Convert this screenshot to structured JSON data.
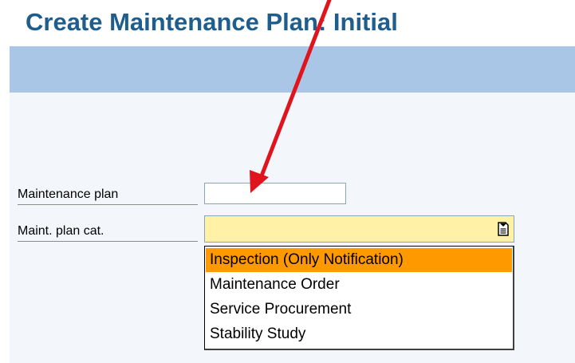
{
  "page": {
    "title": "Create Maintenance Plan: Initial"
  },
  "form": {
    "plan_label": "Maintenance plan",
    "plan_value": "",
    "category_label": "Maint. plan cat.",
    "category_value": ""
  },
  "dropdown": {
    "options": [
      {
        "label": "Inspection (Only Notification)",
        "selected": true
      },
      {
        "label": "Maintenance Order",
        "selected": false
      },
      {
        "label": "Service Procurement",
        "selected": false
      },
      {
        "label": "Stability Study",
        "selected": false
      }
    ]
  },
  "annotation": {
    "arrow_color": "#e0141c"
  },
  "colors": {
    "title": "#1e5d8c",
    "toolbar": "#a9c6e7",
    "selected_field": "#fff2a6",
    "highlight": "#ff9900"
  }
}
